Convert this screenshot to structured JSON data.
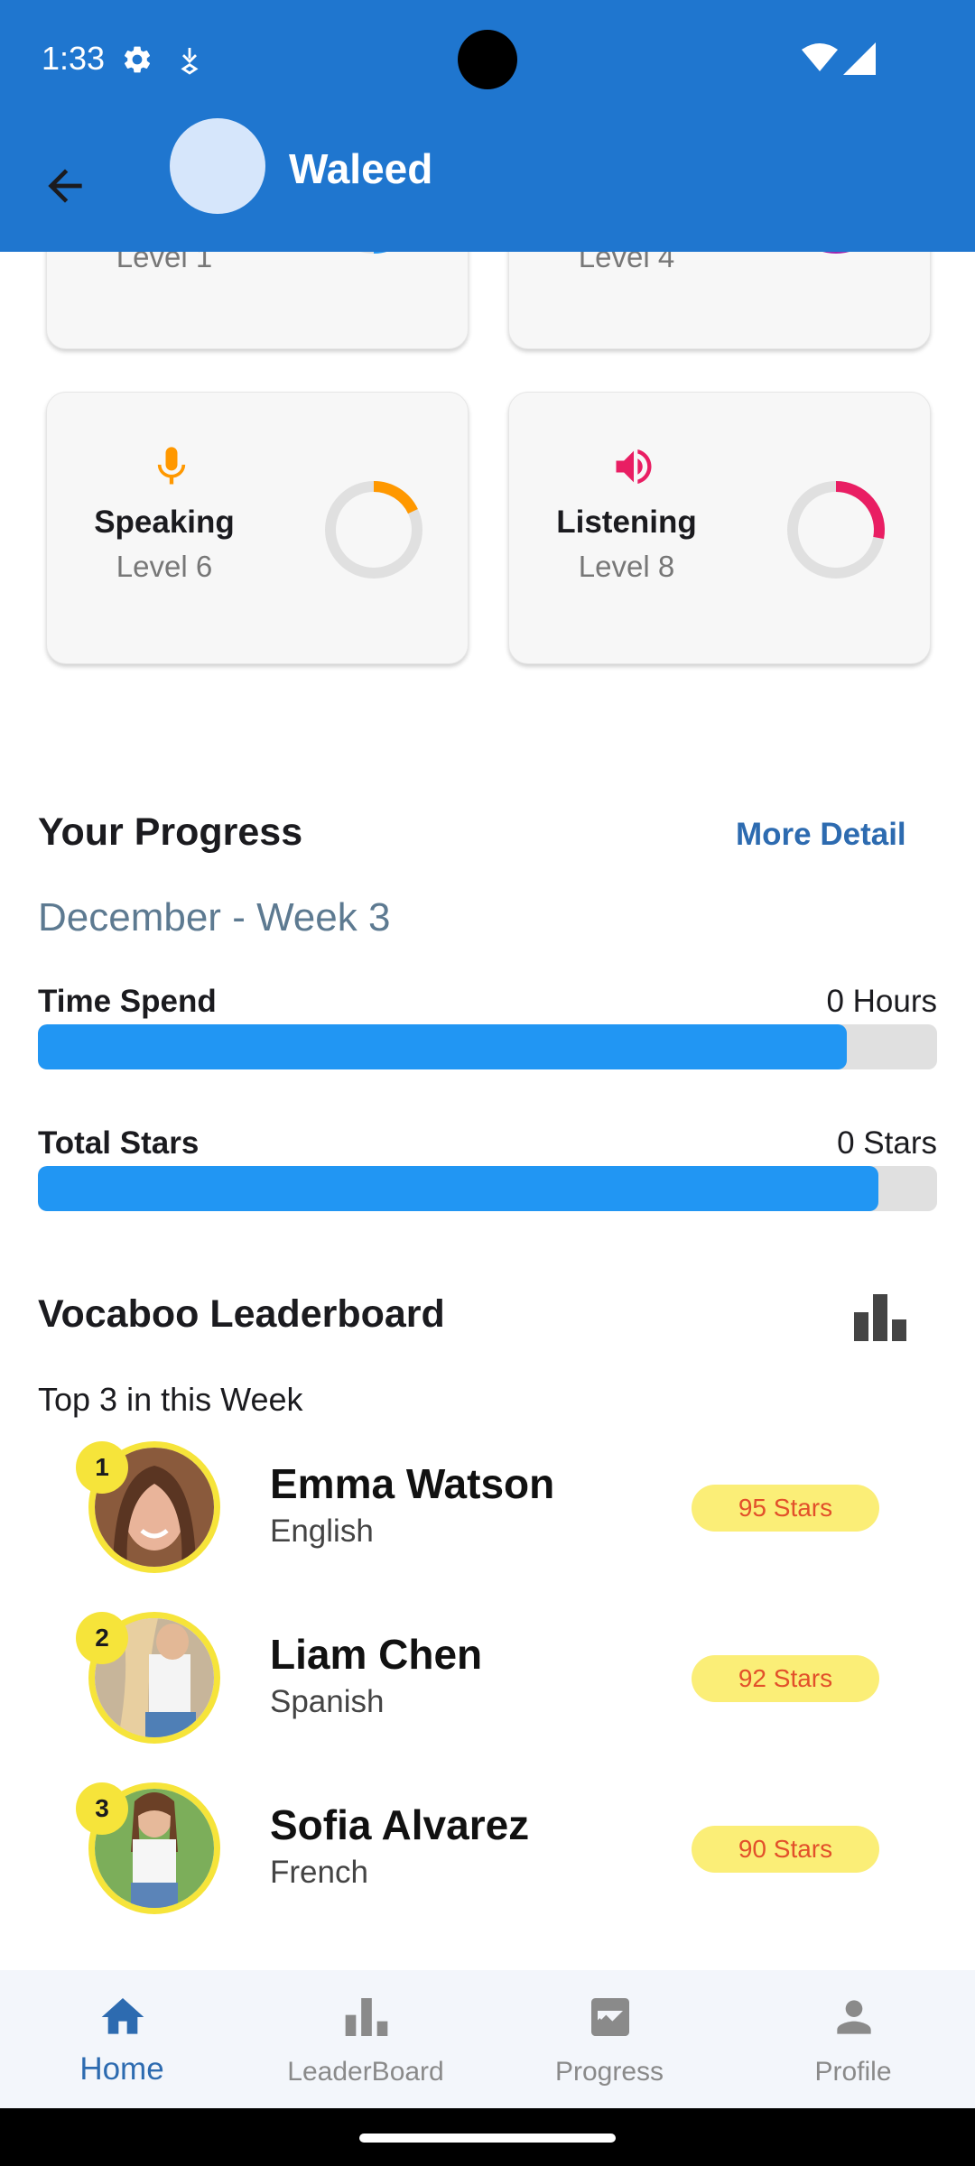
{
  "status_bar": {
    "time": "1:33"
  },
  "header": {
    "user_name": "Waleed"
  },
  "skills_partial": [
    {
      "level": "Level 1",
      "color": "#2196f3"
    },
    {
      "level": "Level 4",
      "color": "#9c27b0"
    }
  ],
  "skills": [
    {
      "name": "Speaking",
      "level": "Level 6",
      "icon": "microphone-icon",
      "color": "#ff9800",
      "progress": 0.18
    },
    {
      "name": "Listening",
      "level": "Level 8",
      "icon": "speaker-icon",
      "color": "#e91e63",
      "progress": 0.28
    }
  ],
  "progress": {
    "title": "Your Progress",
    "more_detail": "More Detail",
    "week": "December - Week 3",
    "time_spend": {
      "label": "Time Spend",
      "value": "0 Hours",
      "fill": 0.9
    },
    "total_stars": {
      "label": "Total Stars",
      "value": "0 Stars",
      "fill": 0.935
    }
  },
  "leaderboard": {
    "title": "Vocaboo Leaderboard",
    "subtitle": "Top 3 in this Week",
    "entries": [
      {
        "rank": "1",
        "name": "Emma Watson",
        "language": "English",
        "stars": "95 Stars"
      },
      {
        "rank": "2",
        "name": "Liam Chen",
        "language": "Spanish",
        "stars": "92 Stars"
      },
      {
        "rank": "3",
        "name": "Sofia Alvarez",
        "language": "French",
        "stars": "90 Stars"
      }
    ]
  },
  "bottom_nav": {
    "items": [
      {
        "label": "Home",
        "icon": "home-icon",
        "active": true
      },
      {
        "label": "LeaderBoard",
        "icon": "leaderboard-icon",
        "active": false
      },
      {
        "label": "Progress",
        "icon": "progress-icon",
        "active": false
      },
      {
        "label": "Profile",
        "icon": "profile-icon",
        "active": false
      }
    ]
  },
  "colors": {
    "primary": "#1f76cf",
    "bar_fill": "#2196f3",
    "badge": "#f6e43a",
    "stars_text": "#e2502a"
  }
}
